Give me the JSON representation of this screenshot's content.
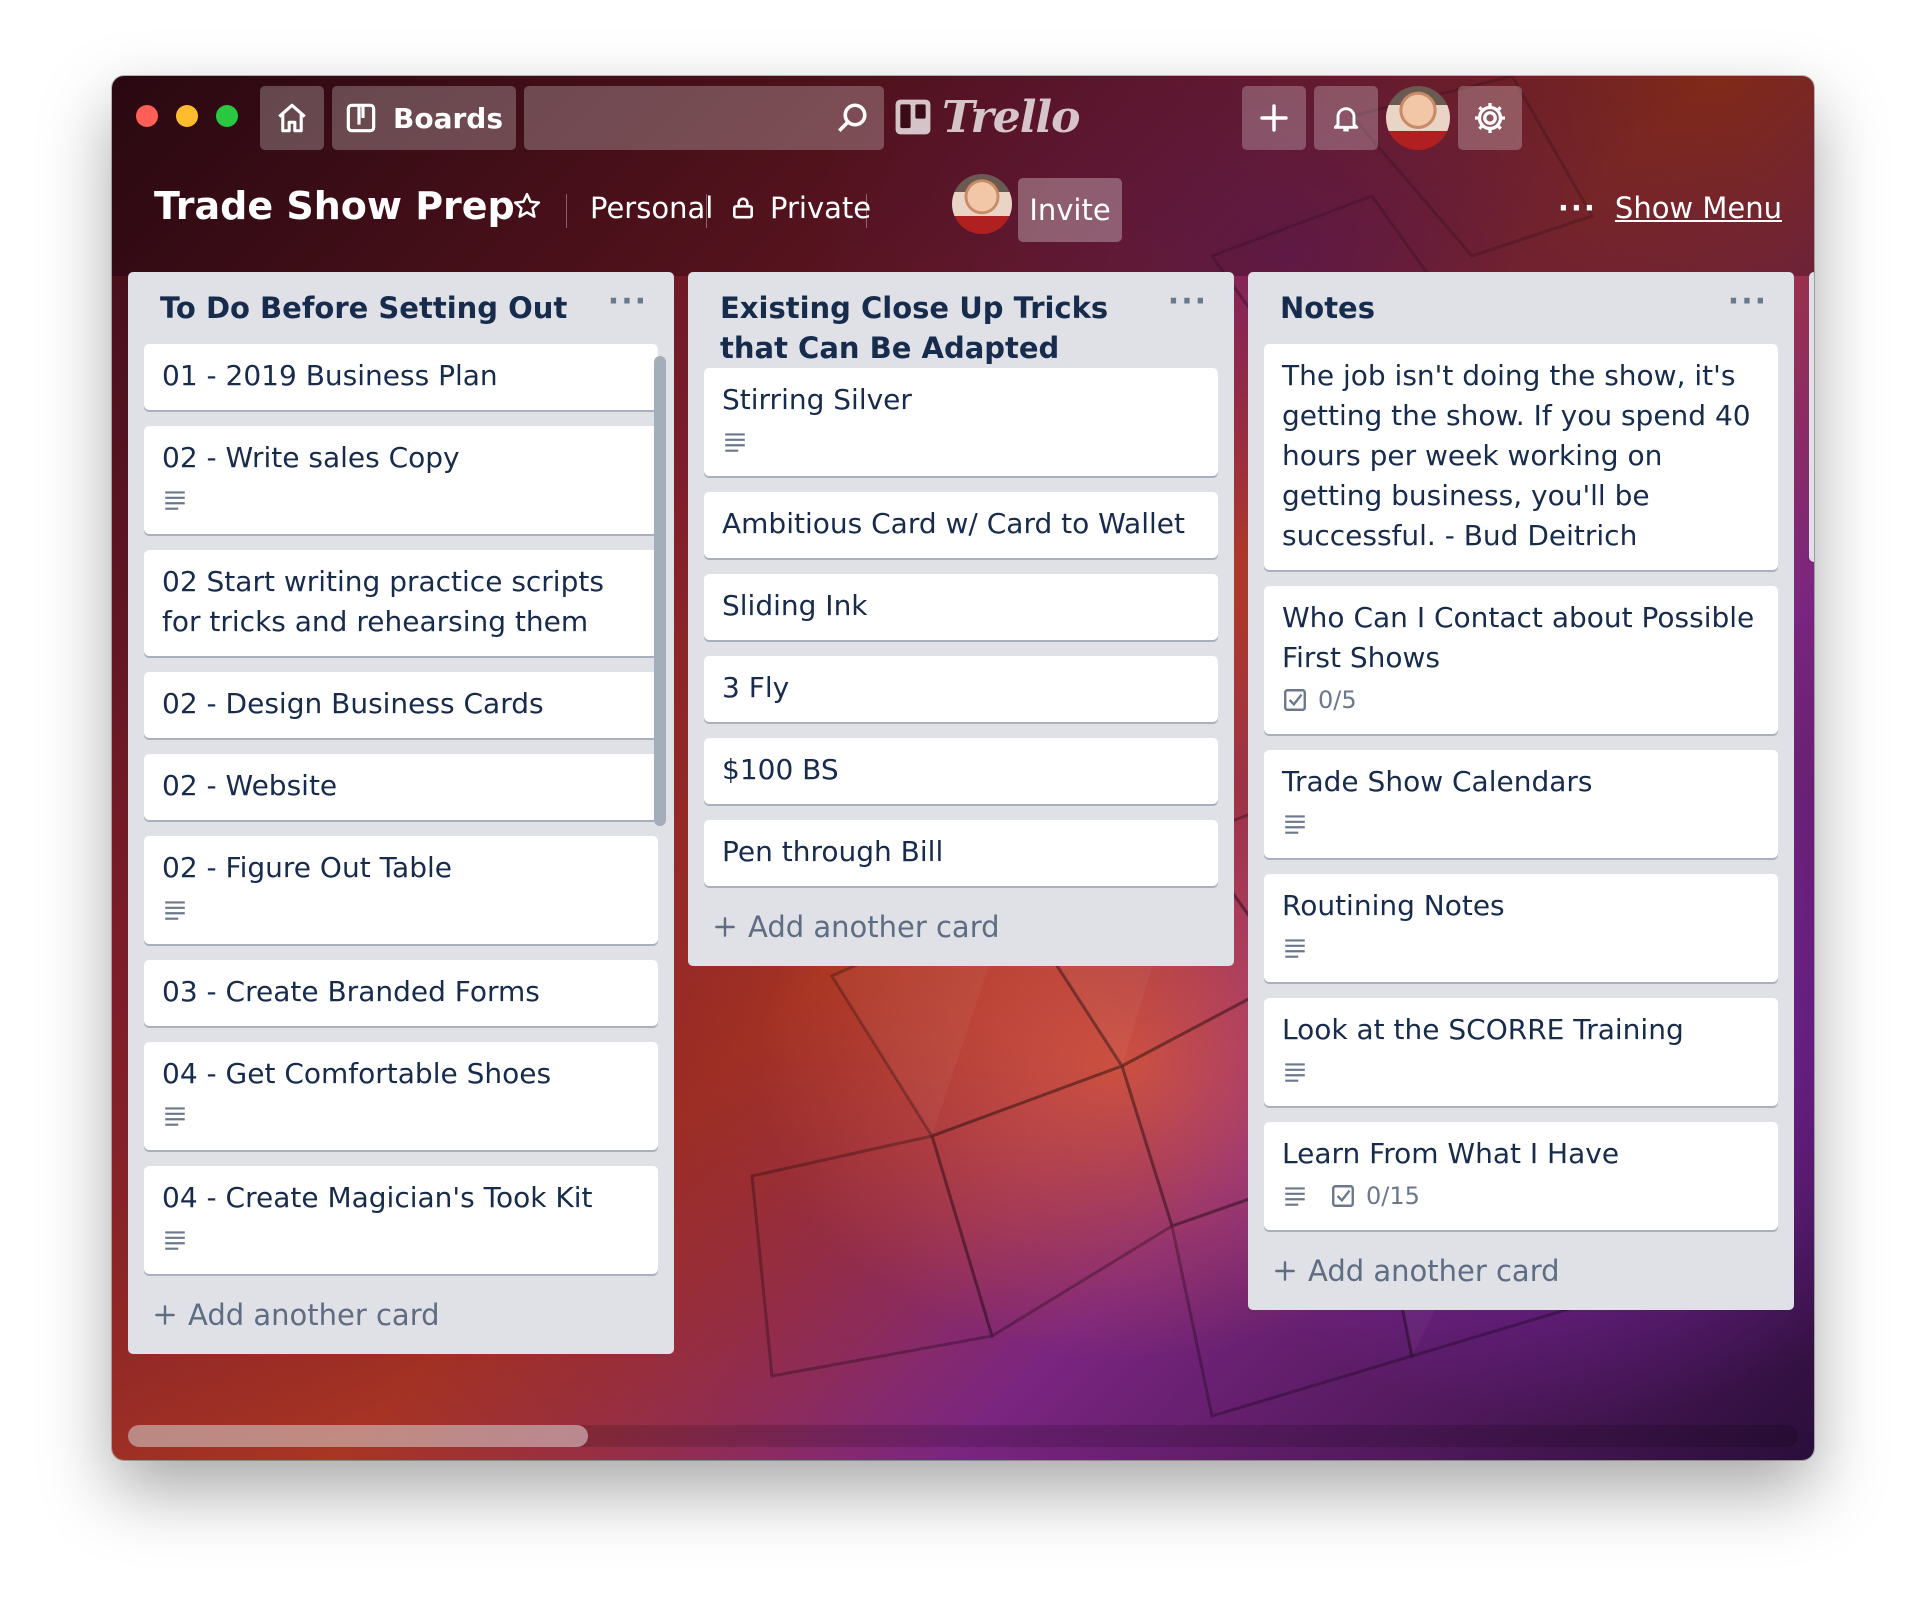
{
  "window": {
    "traffic_lights": [
      "#ff5f57",
      "#febc2e",
      "#28c840"
    ]
  },
  "topbar": {
    "home_icon": "home-icon",
    "boards_label": "Boards",
    "search_placeholder": "",
    "logo_text": "Trello",
    "create_icon": "plus-icon",
    "notifications_icon": "bell-icon",
    "settings_icon": "gear-icon"
  },
  "board": {
    "title": "Trade Show Prep",
    "star_icon": "star-icon",
    "team_label": "Personal",
    "visibility_label": "Private",
    "invite_label": "Invite",
    "menu_label": "Show Menu"
  },
  "lists": [
    {
      "title": "To Do Before Setting Out",
      "add_label": "Add another card",
      "cards": [
        {
          "title": "01 - 2019 Business Plan",
          "description": false
        },
        {
          "title": "02 - Write sales Copy",
          "description": true
        },
        {
          "title": "02 Start writing practice scripts for tricks and rehearsing them",
          "description": false
        },
        {
          "title": "02 - Design Business Cards",
          "description": false
        },
        {
          "title": "02 - Website",
          "description": false
        },
        {
          "title": "02 - Figure Out Table",
          "description": true
        },
        {
          "title": "03 - Create Branded Forms",
          "description": false
        },
        {
          "title": "04 - Get Comfortable Shoes",
          "description": true
        },
        {
          "title": "04 - Create Magician's Took Kit",
          "description": true
        }
      ]
    },
    {
      "title": "Existing Close Up Tricks that Can Be Adapted",
      "add_label": "Add another card",
      "cards": [
        {
          "title": "Stirring Silver",
          "description": true
        },
        {
          "title": "Ambitious Card w/ Card to Wallet",
          "description": false
        },
        {
          "title": "Sliding Ink",
          "description": false
        },
        {
          "title": "3 Fly",
          "description": false
        },
        {
          "title": "$100 BS",
          "description": false
        },
        {
          "title": "Pen through Bill",
          "description": false
        }
      ]
    },
    {
      "title": "Notes",
      "add_label": "Add another card",
      "cards": [
        {
          "title": "The job isn't doing the show, it's getting the show. If you spend 40 hours per week working on getting business, you'll be successful. - Bud Deitrich",
          "description": false
        },
        {
          "title": "Who Can I Contact about Possible First Shows",
          "description": false,
          "checklist": "0/5"
        },
        {
          "title": "Trade Show Calendars",
          "description": true
        },
        {
          "title": "Routining Notes",
          "description": true
        },
        {
          "title": "Look at the SCORRE Training",
          "description": true
        },
        {
          "title": "Learn From What I Have",
          "description": true,
          "checklist": "0/15"
        }
      ]
    }
  ]
}
